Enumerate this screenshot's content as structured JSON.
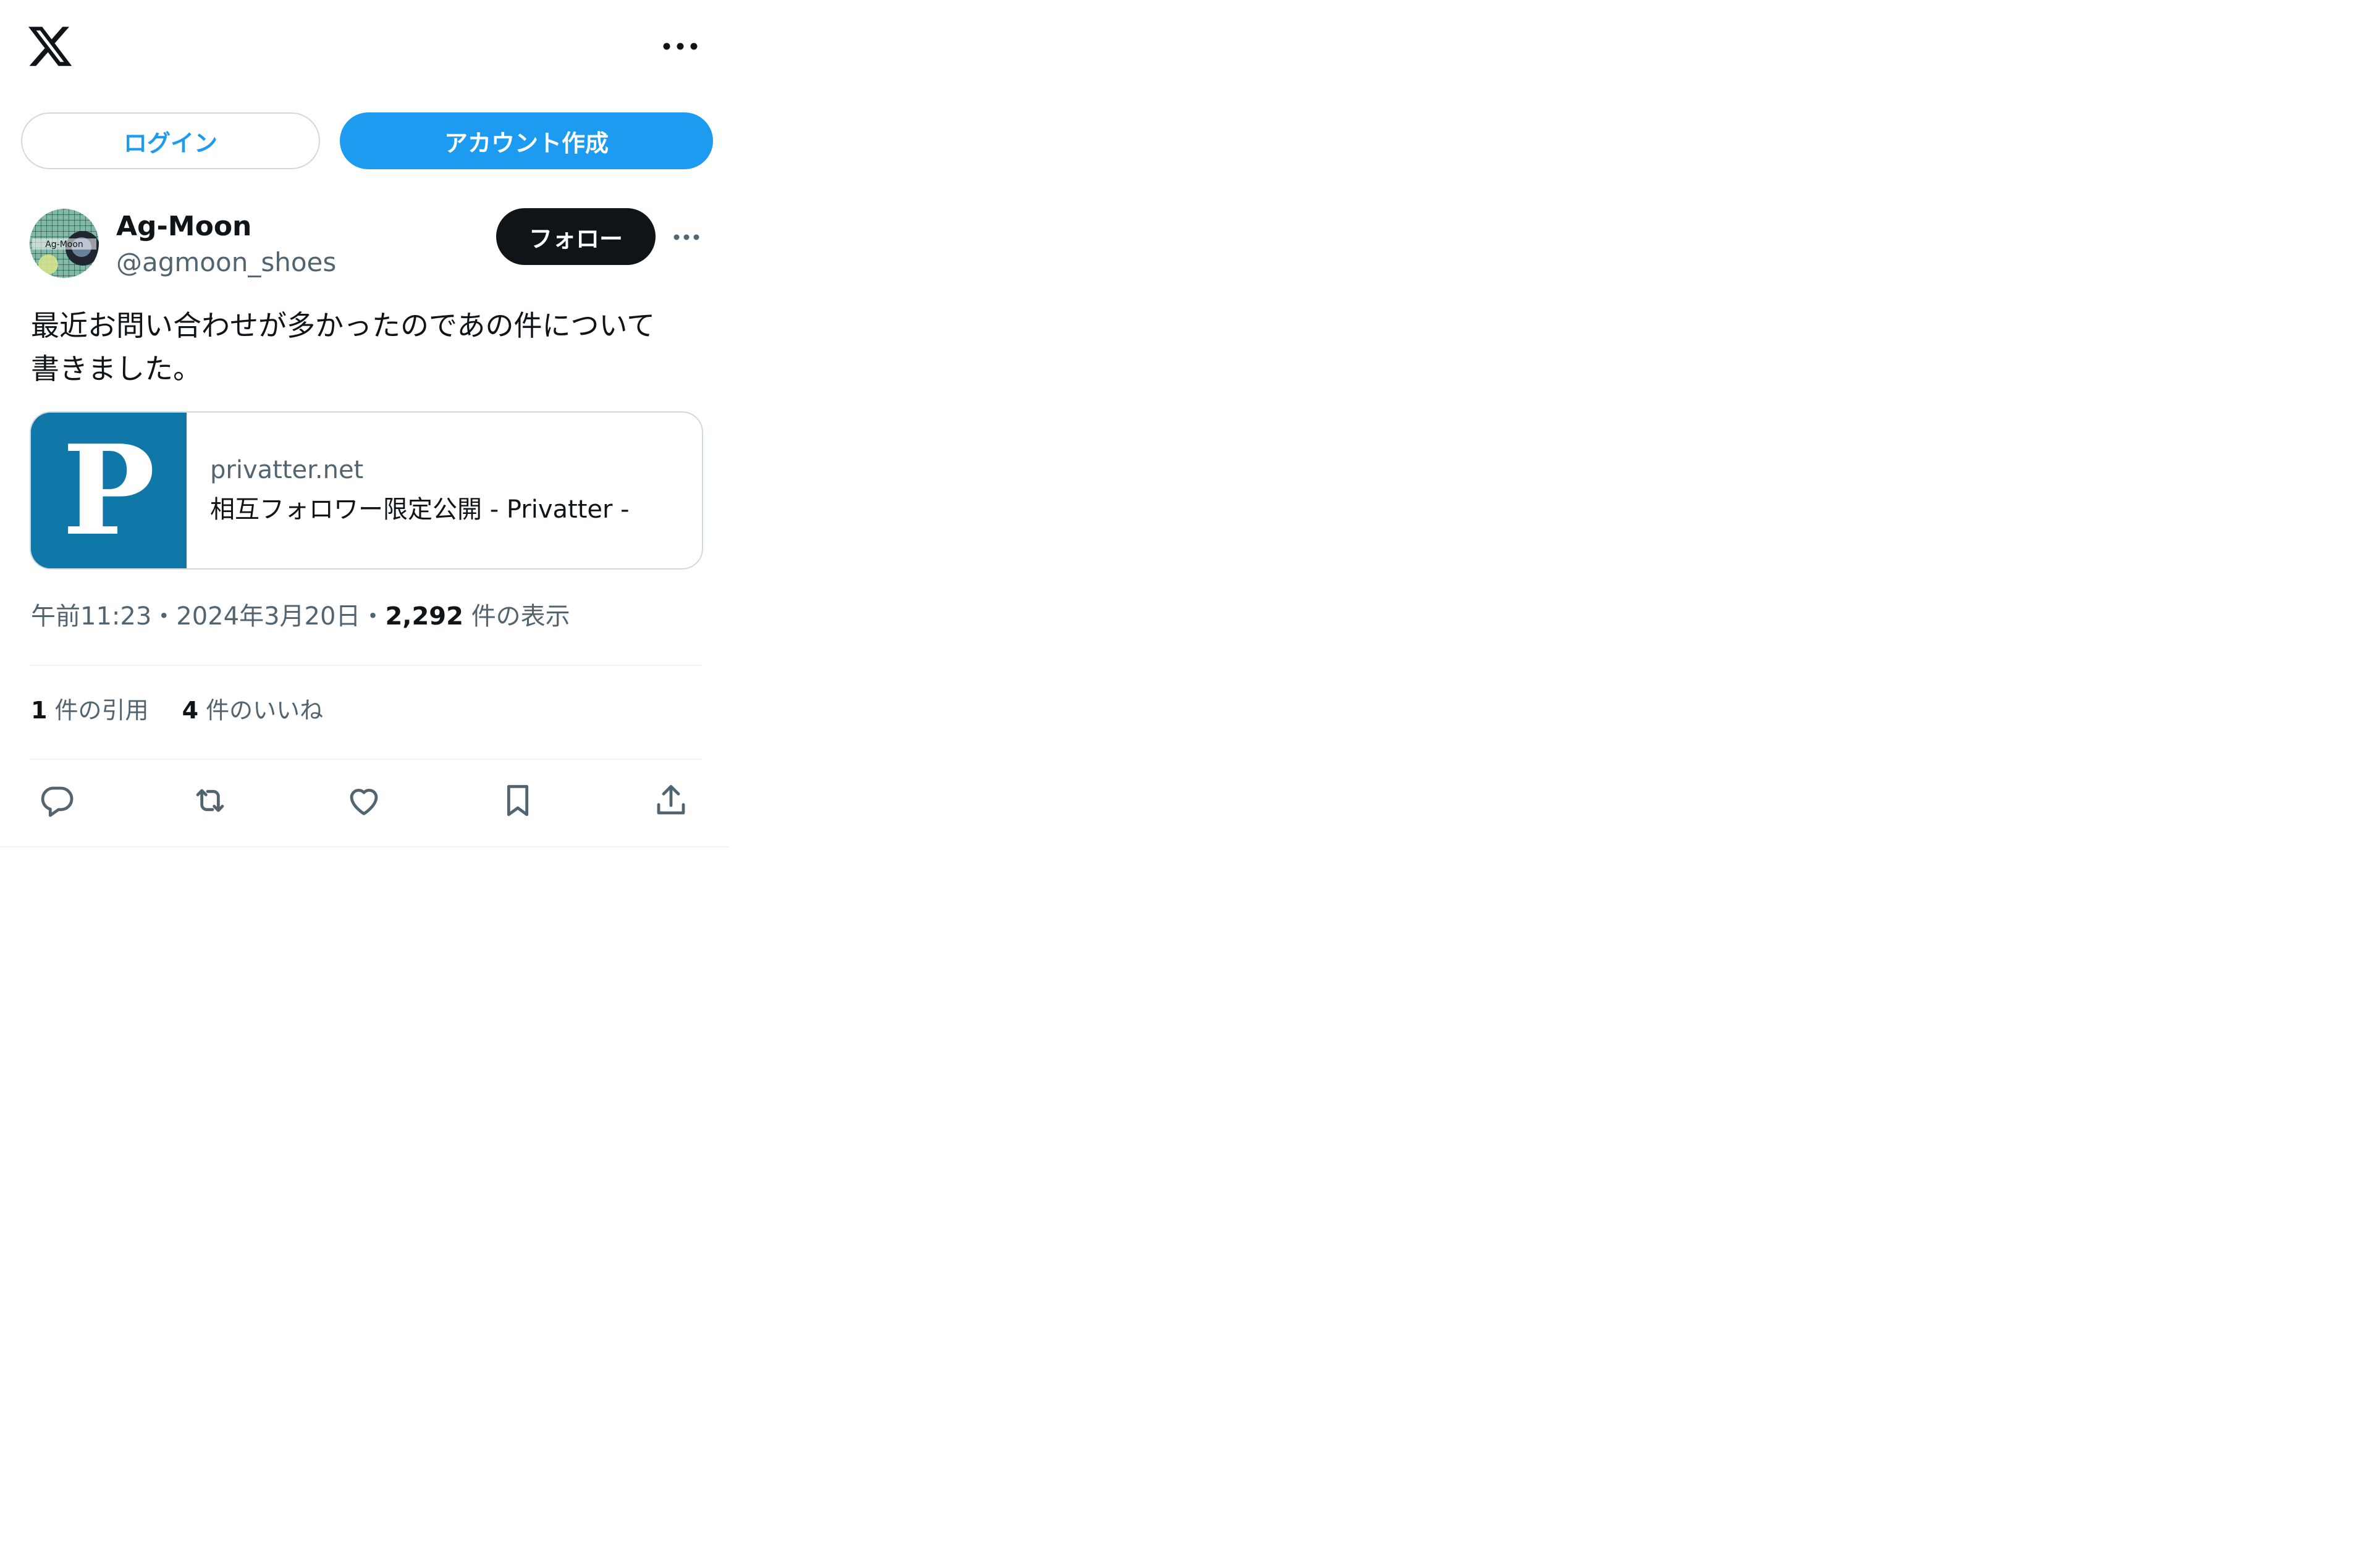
{
  "topbar": {
    "logo_icon": "x-logo-icon",
    "more_icon": "more-horizontal-icon"
  },
  "auth": {
    "login_label": "ログイン",
    "signup_label": "アカウント作成"
  },
  "colors": {
    "accent": "#1d9bf0",
    "text": "#0f1419",
    "muted": "#536471",
    "card_thumb": "#0f78a8"
  },
  "post": {
    "author": {
      "display_name": "Ag-Moon",
      "handle": "@agmoon_shoes",
      "avatar_text": "Ag-Moon"
    },
    "follow_label": "フォロー",
    "text": "最近お問い合わせが多かったのであの件について\n書きました。",
    "card": {
      "thumb_letter": "P",
      "domain": "privatter.net",
      "title": "相互フォロワー限定公開 - Privatter -"
    },
    "time": "午前11:23",
    "separator": "・",
    "date": "2024年3月20日",
    "views_count": "2,292",
    "views_label": "件の表示",
    "stats": {
      "quotes_count": "1",
      "quotes_label": "件の引用",
      "likes_count": "4",
      "likes_label": "件のいいね"
    },
    "actions": [
      "reply-icon",
      "repost-icon",
      "like-icon",
      "bookmark-icon",
      "share-icon"
    ]
  }
}
